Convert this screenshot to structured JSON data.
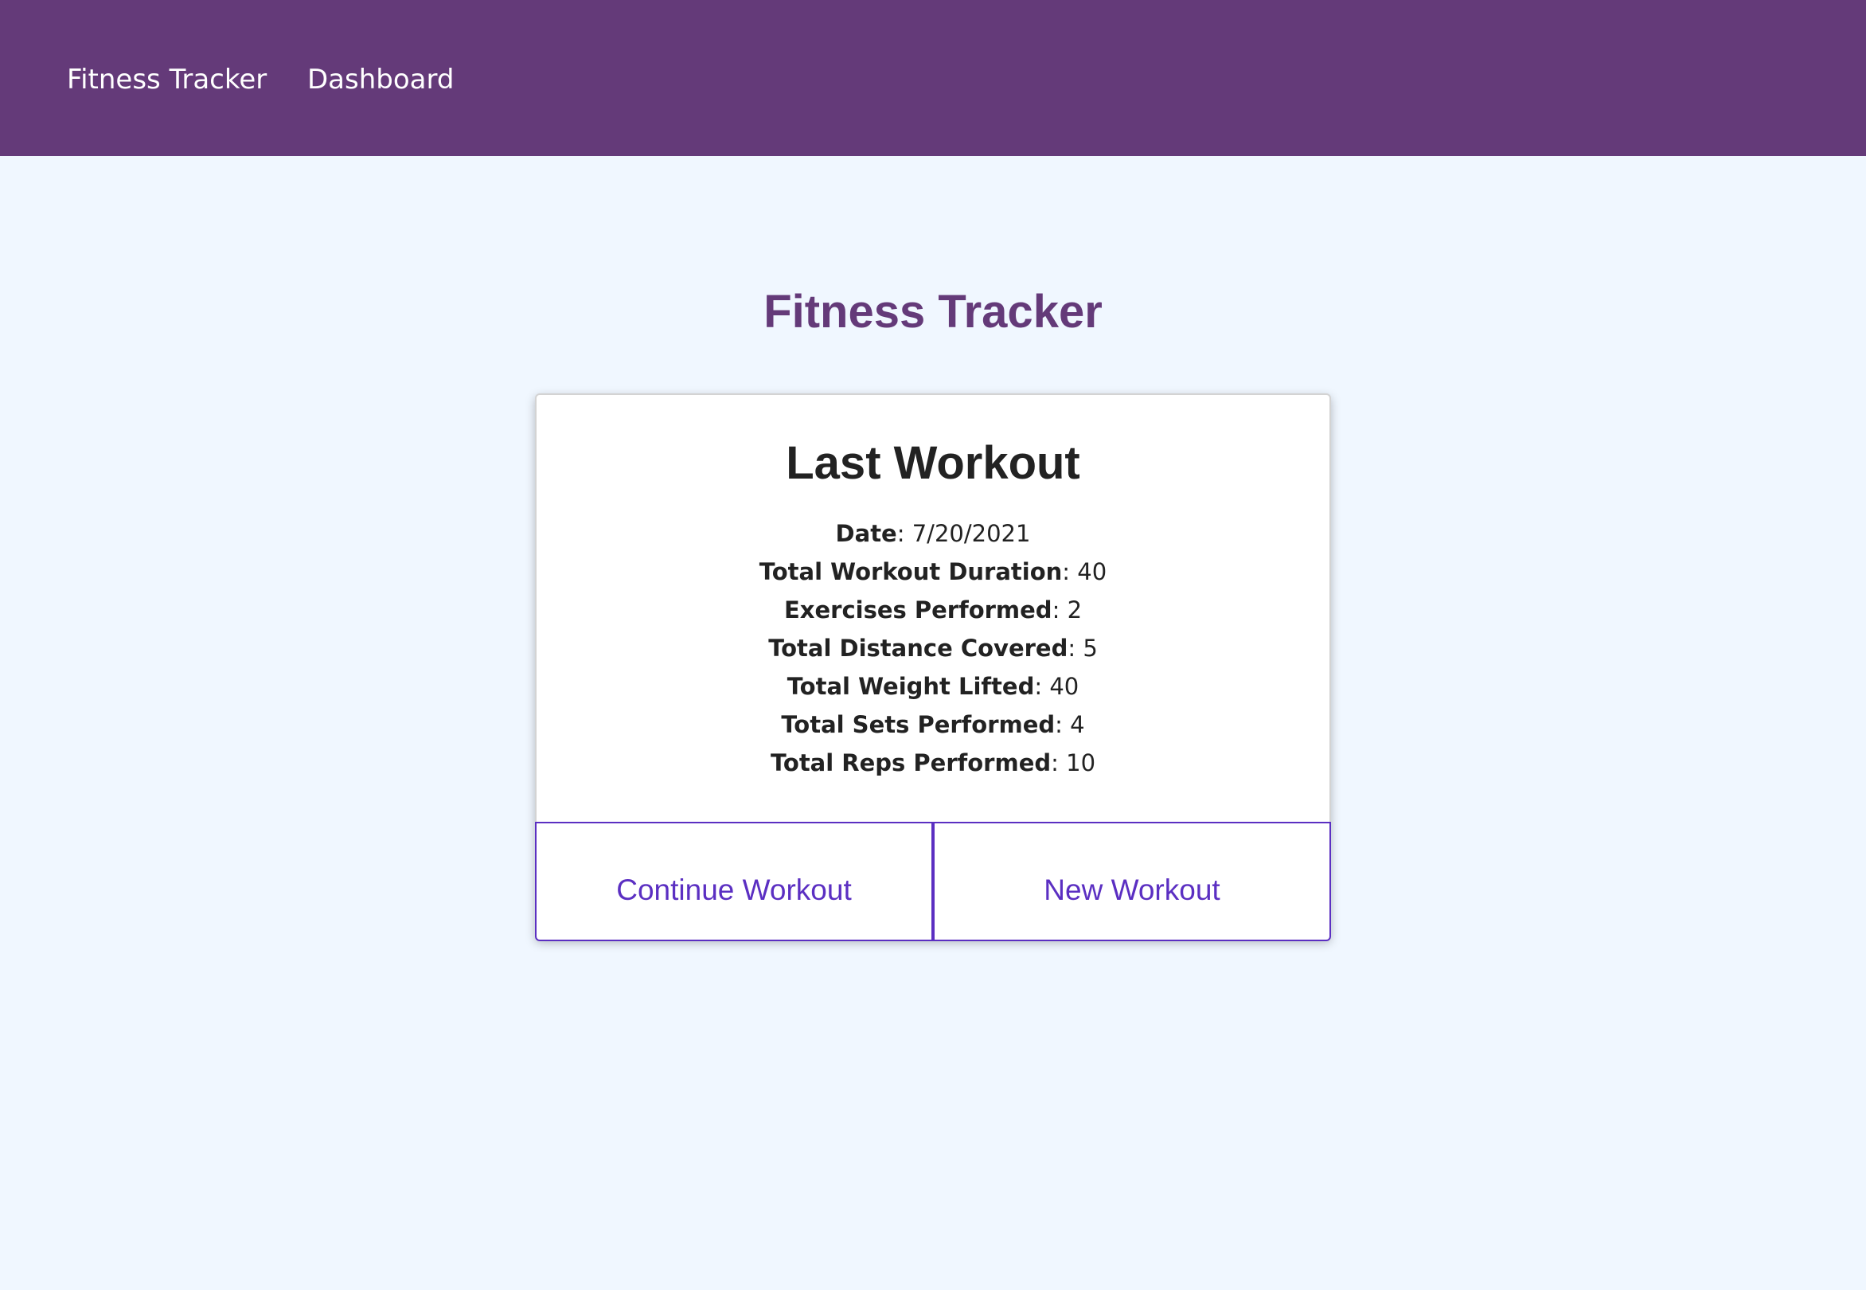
{
  "nav": {
    "brand": "Fitness Tracker",
    "links": [
      {
        "label": "Dashboard"
      }
    ]
  },
  "page": {
    "title": "Fitness Tracker"
  },
  "card": {
    "title": "Last Workout",
    "stats": [
      {
        "label": "Date",
        "separator": ": ",
        "value": "7/20/2021"
      },
      {
        "label": "Total Workout Duration",
        "separator": ": ",
        "value": "40"
      },
      {
        "label": "Exercises Performed",
        "separator": ": ",
        "value": "2"
      },
      {
        "label": "Total Distance Covered",
        "separator": ": ",
        "value": "5"
      },
      {
        "label": "Total Weight Lifted",
        "separator": ": ",
        "value": "40"
      },
      {
        "label": "Total Sets Performed",
        "separator": ": ",
        "value": "4"
      },
      {
        "label": "Total Reps Performed",
        "separator": ": ",
        "value": "10"
      }
    ],
    "buttons": {
      "continue_label": "Continue Workout",
      "new_label": "New Workout"
    }
  },
  "colors": {
    "nav_background": "#643a79",
    "page_background": "#f0f7ff",
    "title_color": "#643a79",
    "button_accent": "#5b2fc2"
  }
}
